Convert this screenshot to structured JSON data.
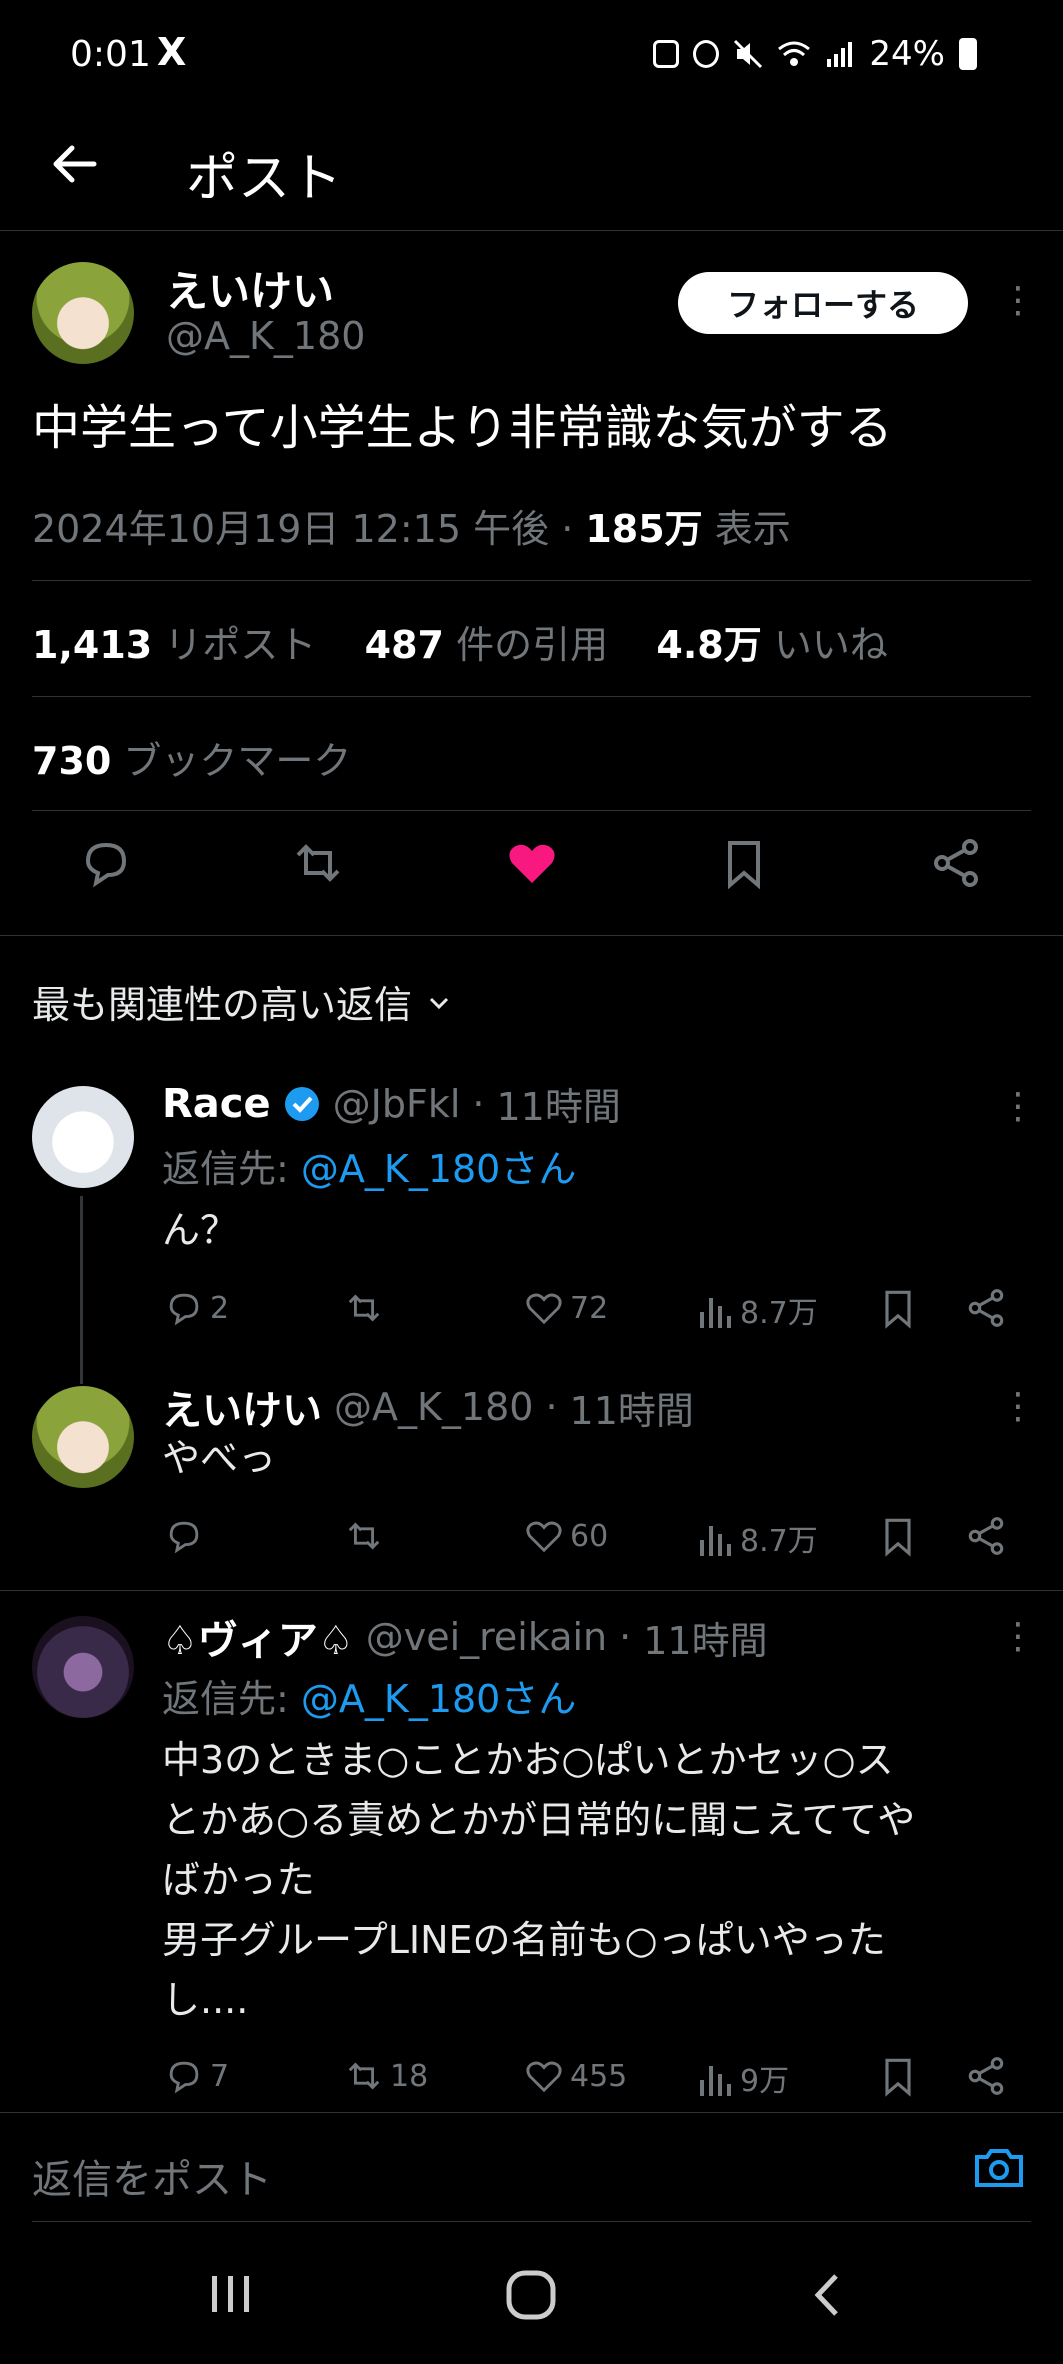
{
  "status_bar": {
    "time": "0:01",
    "app_icon": "X",
    "battery": "24%"
  },
  "header": {
    "title": "ポスト"
  },
  "post": {
    "author_name": "えいけい",
    "author_handle": "@A_K_180",
    "follow_label": "フォローする",
    "text": "中学生って小学生より非常識な気がする",
    "timestamp": "2024年10月19日 12:15 午後",
    "views_value": "185万",
    "views_label": "表示",
    "reposts_value": "1,413",
    "reposts_label": "リポスト",
    "quotes_value": "487",
    "quotes_label": "件の引用",
    "likes_value": "4.8万",
    "likes_label": "いいね",
    "bookmarks_value": "730",
    "bookmarks_label": "ブックマーク"
  },
  "replies_section": {
    "label": "最も関連性の高い返信"
  },
  "replies": [
    {
      "name": "Race",
      "handle": "@JbFkl",
      "time": "11時間",
      "replying_to_label": "返信先:",
      "replying_to_handle": "@A_K_180さん",
      "text": "ん？",
      "comments": "2",
      "reposts": "",
      "likes": "72",
      "views": "8.7万"
    },
    {
      "name": "えいけい",
      "handle": "@A_K_180",
      "time": "11時間",
      "text": "やべっ",
      "comments": "",
      "reposts": "",
      "likes": "60",
      "views": "8.7万"
    },
    {
      "name": "♤ヴィア♤",
      "handle": "@vei_reikain",
      "time": "11時間",
      "replying_to_label": "返信先:",
      "replying_to_handle": "@A_K_180さん",
      "text_lines": [
        "中3のときま○ことかお○ぱいとかセッ○ス",
        "とかあ○る責めとかが日常的に聞こえててや",
        "ばかった",
        "男子グループLINEの名前も○っぱいやった",
        "し...."
      ],
      "comments": "7",
      "reposts": "18",
      "likes": "455",
      "views": "9万"
    }
  ],
  "compose": {
    "placeholder": "返信をポスト"
  },
  "colors": {
    "accent": "#1d9bf0",
    "like": "#f91880",
    "background": "#000000"
  }
}
